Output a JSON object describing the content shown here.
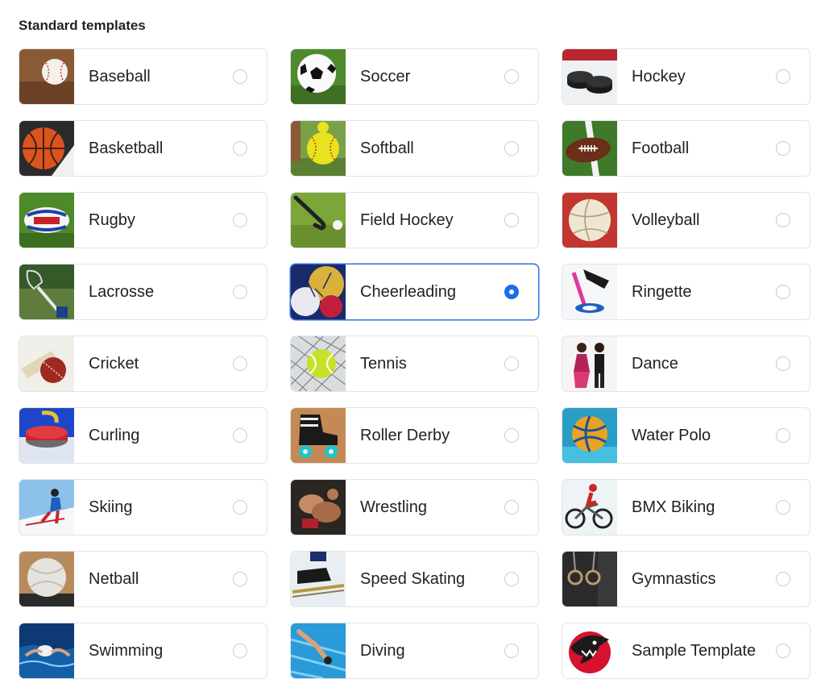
{
  "section": {
    "title": "Standard templates"
  },
  "templates": [
    {
      "label": "Baseball",
      "icon": "baseball-image",
      "selected": false
    },
    {
      "label": "Soccer",
      "icon": "soccer-ball-image",
      "selected": false
    },
    {
      "label": "Hockey",
      "icon": "hockey-puck-image",
      "selected": false
    },
    {
      "label": "Basketball",
      "icon": "basketball-image",
      "selected": false
    },
    {
      "label": "Softball",
      "icon": "softball-image",
      "selected": false
    },
    {
      "label": "Football",
      "icon": "football-image",
      "selected": false
    },
    {
      "label": "Rugby",
      "icon": "rugby-ball-image",
      "selected": false
    },
    {
      "label": "Field Hockey",
      "icon": "field-hockey-image",
      "selected": false
    },
    {
      "label": "Volleyball",
      "icon": "volleyball-image",
      "selected": false
    },
    {
      "label": "Lacrosse",
      "icon": "lacrosse-image",
      "selected": false
    },
    {
      "label": "Cheerleading",
      "icon": "pom-pom-image",
      "selected": true
    },
    {
      "label": "Ringette",
      "icon": "ringette-image",
      "selected": false
    },
    {
      "label": "Cricket",
      "icon": "cricket-image",
      "selected": false
    },
    {
      "label": "Tennis",
      "icon": "tennis-ball-image",
      "selected": false
    },
    {
      "label": "Dance",
      "icon": "dance-image",
      "selected": false
    },
    {
      "label": "Curling",
      "icon": "curling-stone-image",
      "selected": false
    },
    {
      "label": "Roller Derby",
      "icon": "roller-skate-image",
      "selected": false
    },
    {
      "label": "Water Polo",
      "icon": "water-polo-image",
      "selected": false
    },
    {
      "label": "Skiing",
      "icon": "skier-image",
      "selected": false
    },
    {
      "label": "Wrestling",
      "icon": "wrestling-image",
      "selected": false
    },
    {
      "label": "BMX Biking",
      "icon": "bmx-bike-image",
      "selected": false
    },
    {
      "label": "Netball",
      "icon": "netball-image",
      "selected": false
    },
    {
      "label": "Speed Skating",
      "icon": "speed-skate-image",
      "selected": false
    },
    {
      "label": "Gymnastics",
      "icon": "gymnastic-rings-image",
      "selected": false
    },
    {
      "label": "Swimming",
      "icon": "swimmer-image",
      "selected": false
    },
    {
      "label": "Diving",
      "icon": "diver-image",
      "selected": false
    },
    {
      "label": "Sample Template",
      "icon": "shark-logo-image",
      "selected": false
    }
  ],
  "colors": {
    "selected_accent": "#1e6bf0",
    "card_border": "#e1e3e6"
  }
}
